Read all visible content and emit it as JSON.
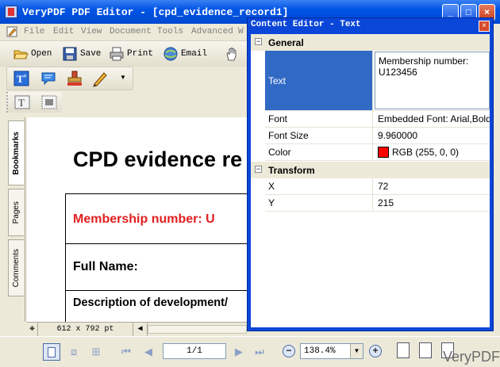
{
  "window": {
    "title": "VeryPDF PDF Editor - [cpd_evidence_record1]"
  },
  "menu": [
    "File",
    "Edit",
    "View",
    "Document",
    "Tools",
    "Advanced",
    "W"
  ],
  "toolbar": {
    "open": "Open",
    "save": "Save",
    "print": "Print",
    "email": "Email"
  },
  "sidetabs": [
    "Bookmarks",
    "Pages",
    "Comments"
  ],
  "document": {
    "heading": "CPD evidence re",
    "membership": "Membership number:  U",
    "full_name": "Full Name:",
    "description": "Description of development/"
  },
  "docstatus": {
    "page_size": "612 x 792 pt"
  },
  "navigation": {
    "page": "1/1",
    "zoom": "138.4%"
  },
  "dialog": {
    "title": "Content Editor - Text",
    "close": "×",
    "sections": {
      "general": "General",
      "transform": "Transform"
    },
    "props": {
      "text_label": "Text",
      "text_value": "Membership number: U123456",
      "font_label": "Font",
      "font_value": "Embedded Font: Arial,Bold",
      "font_size_label": "Font Size",
      "font_size_value": "9.960000",
      "color_label": "Color",
      "color_value": "RGB (255, 0, 0)",
      "color_hex": "#ff0000",
      "x_label": "X",
      "x_value": "72",
      "y_label": "Y",
      "y_value": "215"
    }
  },
  "watermark": "VeryPDF"
}
